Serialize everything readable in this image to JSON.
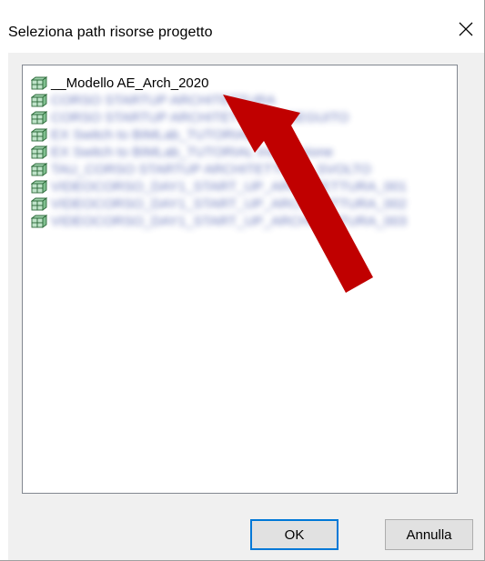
{
  "dialog": {
    "title": "Seleziona path risorse progetto",
    "close_icon": "close-icon"
  },
  "list": {
    "item_icon": "cube-group-icon",
    "items": [
      {
        "label": "__Modello AE_Arch_2020",
        "blurred": false
      },
      {
        "label": "CORSO STARTUP ARCHITETTURA",
        "blurred": true
      },
      {
        "label": "CORSO STARTUP ARCHITETTURA ESEGUITO",
        "blurred": true
      },
      {
        "label": "EX Switch to BIMLab_TUTORIAL",
        "blurred": true
      },
      {
        "label": "EX Switch to BIMLab_TUTORIAL Installazione",
        "blurred": true
      },
      {
        "label": "TAU_CORSO STARTUP ARCHITETTURA_SVOLTO",
        "blurred": true
      },
      {
        "label": "VIDEOCORSO_DAY1_START_UP_ARCHITETTURA_001",
        "blurred": true
      },
      {
        "label": "VIDEOCORSO_DAY1_START_UP_ARCHITETTURA_002",
        "blurred": true
      },
      {
        "label": "VIDEOCORSO_DAY1_START_UP_ARCHITETTURA_003",
        "blurred": true
      }
    ]
  },
  "buttons": {
    "ok_label": "OK",
    "cancel_label": "Annulla"
  },
  "annotation": {
    "arrow_color": "#c00000"
  }
}
